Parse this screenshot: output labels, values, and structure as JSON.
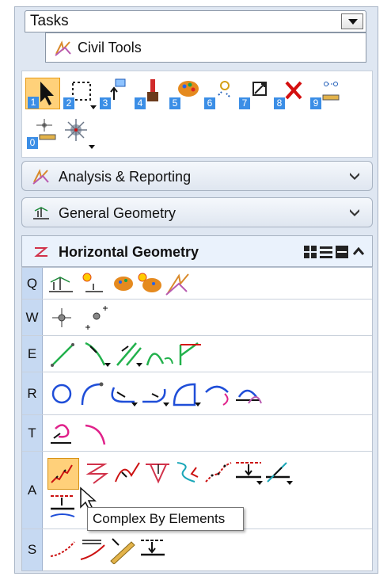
{
  "header": {
    "tasks_label": "Tasks",
    "civil_tab_label": "Civil Tools"
  },
  "main_toolbar": {
    "tools": [
      {
        "num": "1",
        "name": "select-icon"
      },
      {
        "num": "2",
        "name": "fence-icon"
      },
      {
        "num": "3",
        "name": "view-icon"
      },
      {
        "num": "4",
        "name": "paint-icon"
      },
      {
        "num": "5",
        "name": "palette-icon"
      },
      {
        "num": "6",
        "name": "bulb-icon"
      },
      {
        "num": "7",
        "name": "scale-icon"
      },
      {
        "num": "8",
        "name": "delete-icon"
      },
      {
        "num": "9",
        "name": "measure-icon"
      },
      {
        "num": "0",
        "name": "snap-icon"
      }
    ]
  },
  "sections": {
    "analysis": "Analysis & Reporting",
    "general": "General Geometry",
    "horizontal": "Horizontal Geometry"
  },
  "rows": [
    {
      "letter": "Q"
    },
    {
      "letter": "W"
    },
    {
      "letter": "E"
    },
    {
      "letter": "R"
    },
    {
      "letter": "T"
    },
    {
      "letter": "A"
    },
    {
      "letter": "S"
    }
  ],
  "tooltip": "Complex By Elements",
  "colors": {
    "accent_select": "#ffd17a",
    "number_badge": "#3b8ee6",
    "line_green": "#22b14c",
    "line_blue": "#1f4ed8",
    "line_red": "#cc1111"
  }
}
